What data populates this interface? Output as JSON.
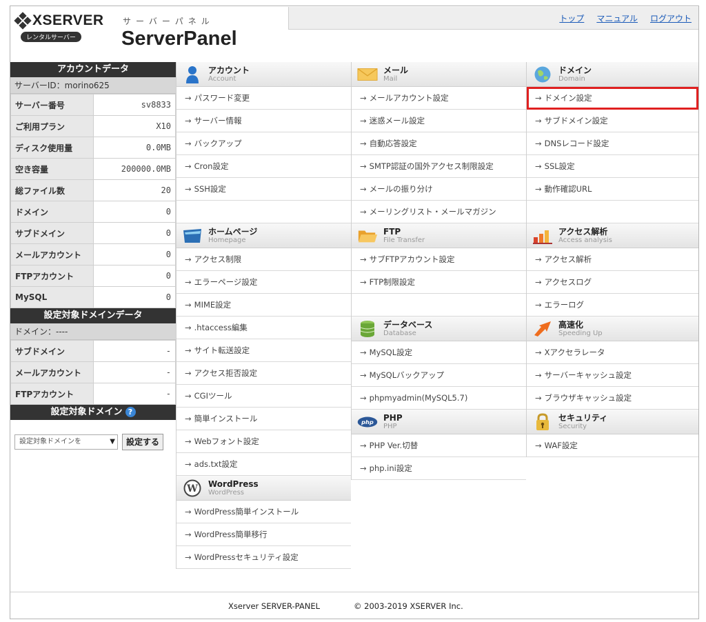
{
  "header": {
    "logo_text": "XSERVER",
    "logo_badge": "レンタルサーバー",
    "panel_kana": "サーバーパネル",
    "panel_title": "ServerPanel",
    "links": [
      "トップ",
      "マニュアル",
      "ログアウト"
    ]
  },
  "account_data": {
    "title": "アカウントデータ",
    "server_id": "サーバーID：morino625",
    "rows": [
      {
        "label": "サーバー番号",
        "value": "sv8833"
      },
      {
        "label": "ご利用プラン",
        "value": "X10"
      },
      {
        "label": "ディスク使用量",
        "value": "0.0MB"
      },
      {
        "label": "空き容量",
        "value": "200000.0MB"
      },
      {
        "label": "総ファイル数",
        "value": "20"
      },
      {
        "label": "ドメイン",
        "value": "0"
      },
      {
        "label": "サブドメイン",
        "value": "0"
      },
      {
        "label": "メールアカウント",
        "value": "0"
      },
      {
        "label": "FTPアカウント",
        "value": "0"
      },
      {
        "label": "MySQL",
        "value": "0"
      }
    ]
  },
  "target_domain_data": {
    "title": "設定対象ドメインデータ",
    "domain_line": "ドメイン：----",
    "rows": [
      {
        "label": "サブドメイン",
        "value": "-"
      },
      {
        "label": "メールアカウント",
        "value": "-"
      },
      {
        "label": "FTPアカウント",
        "value": "-"
      }
    ]
  },
  "target_domain": {
    "title": "設定対象ドメイン",
    "help": "?",
    "select_value": "設定対象ドメインを",
    "set_button": "設定する"
  },
  "sections": {
    "account": {
      "jp": "アカウント",
      "en": "Account",
      "icon": "user-icon",
      "items": [
        "パスワード変更",
        "サーバー情報",
        "バックアップ",
        "Cron設定",
        "SSH設定",
        ""
      ]
    },
    "homepage": {
      "jp": "ホームページ",
      "en": "Homepage",
      "icon": "folder-icon",
      "items": [
        "アクセス制限",
        "エラーページ設定",
        "MIME設定",
        ".htaccess編集",
        "サイト転送設定",
        "アクセス拒否設定",
        "CGIツール",
        "簡単インストール",
        "Webフォント設定",
        "ads.txt設定"
      ]
    },
    "wordpress": {
      "jp": "WordPress",
      "en": "WordPress",
      "icon": "wordpress-icon",
      "items": [
        "WordPress簡単インストール",
        "WordPress簡単移行",
        "WordPressセキュリティ設定"
      ]
    },
    "mail": {
      "jp": "メール",
      "en": "Mail",
      "icon": "envelope-icon",
      "items": [
        "メールアカウント設定",
        "迷惑メール設定",
        "自動応答設定",
        "SMTP認証の国外アクセス制限設定",
        "メールの振り分け",
        "メーリングリスト・メールマガジン"
      ]
    },
    "ftp": {
      "jp": "FTP",
      "en": "File Transfer",
      "icon": "open-folder-icon",
      "items": [
        "サブFTPアカウント設定",
        "FTP制限設定",
        ""
      ]
    },
    "database": {
      "jp": "データベース",
      "en": "Database",
      "icon": "database-icon",
      "items": [
        "MySQL設定",
        "MySQLバックアップ",
        "phpmyadmin(MySQL5.7)"
      ]
    },
    "php": {
      "jp": "PHP",
      "en": "PHP",
      "icon": "php-icon",
      "items": [
        "PHP Ver.切替",
        "php.ini設定"
      ]
    },
    "domain": {
      "jp": "ドメイン",
      "en": "Domain",
      "icon": "globe-icon",
      "items": [
        "ドメイン設定",
        "サブドメイン設定",
        "DNSレコード設定",
        "SSL設定",
        "動作確認URL",
        ""
      ]
    },
    "access": {
      "jp": "アクセス解析",
      "en": "Access analysis",
      "icon": "bar-chart-icon",
      "items": [
        "アクセス解析",
        "アクセスログ",
        "エラーログ"
      ]
    },
    "speed": {
      "jp": "高速化",
      "en": "Speeding Up",
      "icon": "speed-icon",
      "items": [
        "Xアクセラレータ",
        "サーバーキャッシュ設定",
        "ブラウザキャッシュ設定"
      ]
    },
    "security": {
      "jp": "セキュリティ",
      "en": "Security",
      "icon": "lock-icon",
      "items": [
        "WAF設定"
      ]
    }
  },
  "footer": {
    "left": "Xserver SERVER-PANEL",
    "right": "© 2003-2019 XSERVER Inc."
  }
}
